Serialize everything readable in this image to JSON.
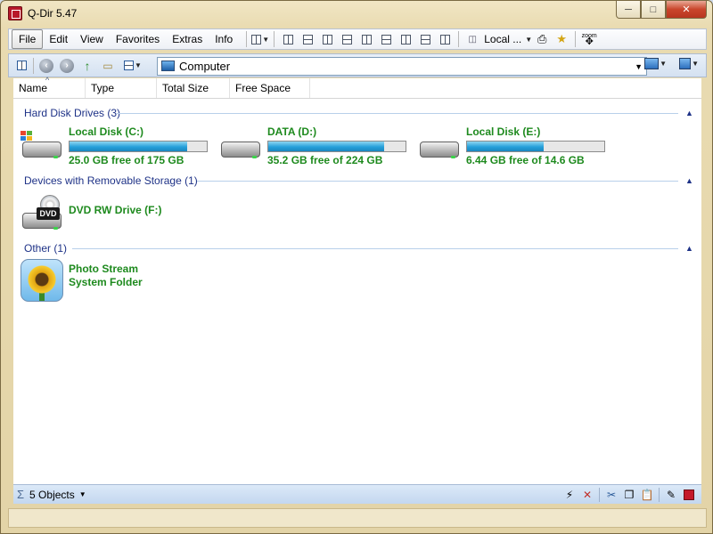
{
  "window": {
    "title": "Q-Dir 5.47",
    "minimize": "─",
    "maximize": "□",
    "close": "✕"
  },
  "menu": {
    "items": [
      "File",
      "Edit",
      "View",
      "Favorites",
      "Extras",
      "Info"
    ],
    "location_label": "Local ...",
    "zoom_label": "zoom"
  },
  "address": {
    "value": "Computer"
  },
  "columns": [
    "Name",
    "Type",
    "Total Size",
    "Free Space"
  ],
  "groups": [
    {
      "title": "Hard Disk Drives (3)"
    },
    {
      "title": "Devices with Removable Storage (1)"
    },
    {
      "title": "Other (1)"
    }
  ],
  "drives": [
    {
      "name": "Local Disk (C:)",
      "free": "25.0 GB free of 175 GB",
      "used_fraction": 0.857
    },
    {
      "name": "DATA (D:)",
      "free": "35.2 GB free of 224 GB",
      "used_fraction": 0.843
    },
    {
      "name": "Local Disk (E:)",
      "free": "6.44 GB free of 14.6 GB",
      "used_fraction": 0.559
    }
  ],
  "removable": {
    "name": "DVD RW Drive (F:)",
    "badge": "DVD"
  },
  "other": {
    "line1": "Photo Stream",
    "line2": "System Folder"
  },
  "status": {
    "sigma": "Σ",
    "count": "5 Objects"
  }
}
